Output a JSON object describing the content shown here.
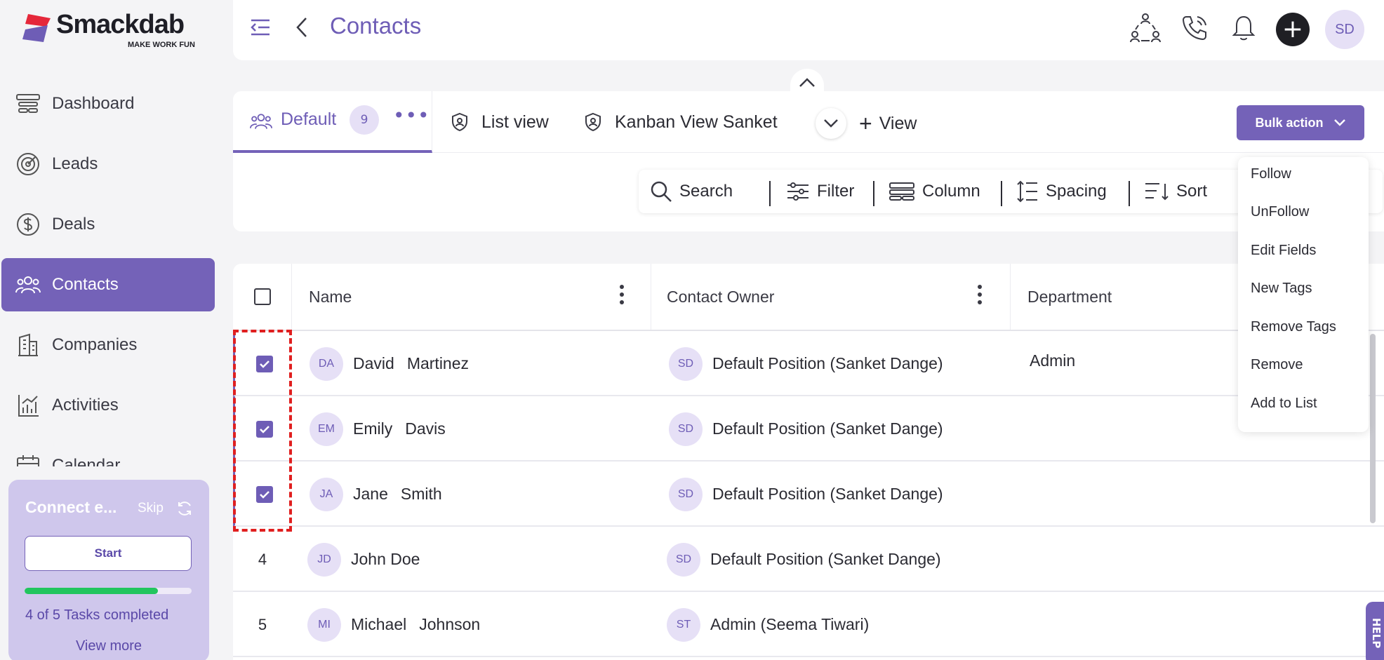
{
  "brand": {
    "name": "Smackdab",
    "tagline": "MAKE WORK FUN",
    "accent": "#7462b8",
    "logo_colors": [
      "#e5273a",
      "#6e5db6"
    ]
  },
  "sidebar": {
    "items": [
      {
        "label": "Dashboard",
        "icon": "dashboard-icon",
        "active": false
      },
      {
        "label": "Leads",
        "icon": "target-icon",
        "active": false
      },
      {
        "label": "Deals",
        "icon": "dollar-icon",
        "active": false
      },
      {
        "label": "Contacts",
        "icon": "contacts-icon",
        "active": true
      },
      {
        "label": "Companies",
        "icon": "building-icon",
        "active": false
      },
      {
        "label": "Activities",
        "icon": "chart-icon",
        "active": false
      },
      {
        "label": "Calendar",
        "icon": "calendar-icon",
        "active": false
      }
    ]
  },
  "connect_card": {
    "title": "Connect e...",
    "skip": "Skip",
    "start": "Start",
    "tasks_text": "4 of 5 Tasks completed",
    "progress": 0.8,
    "view_more": "View more"
  },
  "header": {
    "title": "Contacts",
    "avatar": "SD",
    "icons": [
      "team-icon",
      "phone-icon",
      "bell-icon",
      "plus-icon"
    ],
    "plus": "+"
  },
  "views": {
    "default_tab": {
      "label": "Default",
      "count": "9",
      "more": "•••"
    },
    "tabs": [
      {
        "label": "List view"
      },
      {
        "label": "Kanban View Sanket"
      }
    ],
    "add_view": "View",
    "add_plus": "+",
    "bulk_action": "Bulk action"
  },
  "toolbar": {
    "search": "Search",
    "filter": "Filter",
    "column": "Column",
    "spacing": "Spacing",
    "sort": "Sort"
  },
  "table": {
    "columns": [
      "Name",
      "Contact Owner",
      "Department"
    ],
    "rows": [
      {
        "num": "",
        "checked": true,
        "initials": "DA",
        "first": "David",
        "last": "Martinez",
        "owner_initials": "SD",
        "owner": "Default Position (Sanket Dange)",
        "department": "Admin"
      },
      {
        "num": "",
        "checked": true,
        "initials": "EM",
        "first": "Emily",
        "last": "Davis",
        "owner_initials": "SD",
        "owner": "Default Position (Sanket Dange)",
        "department": ""
      },
      {
        "num": "",
        "checked": true,
        "initials": "JA",
        "first": "Jane",
        "last": "Smith",
        "owner_initials": "SD",
        "owner": "Default Position (Sanket Dange)",
        "department": ""
      },
      {
        "num": "4",
        "checked": false,
        "initials": "JD",
        "first": "John Doe",
        "last": "",
        "owner_initials": "SD",
        "owner": "Default Position (Sanket Dange)",
        "department": ""
      },
      {
        "num": "5",
        "checked": false,
        "initials": "MI",
        "first": "Michael",
        "last": "Johnson",
        "owner_initials": "ST",
        "owner": "Admin (Seema Tiwari)",
        "department": ""
      }
    ]
  },
  "bulk_menu": [
    "Follow",
    "UnFollow",
    "Edit Fields",
    "New Tags",
    "Remove Tags",
    "Remove",
    "Add to List"
  ],
  "help_tab": "HELP"
}
